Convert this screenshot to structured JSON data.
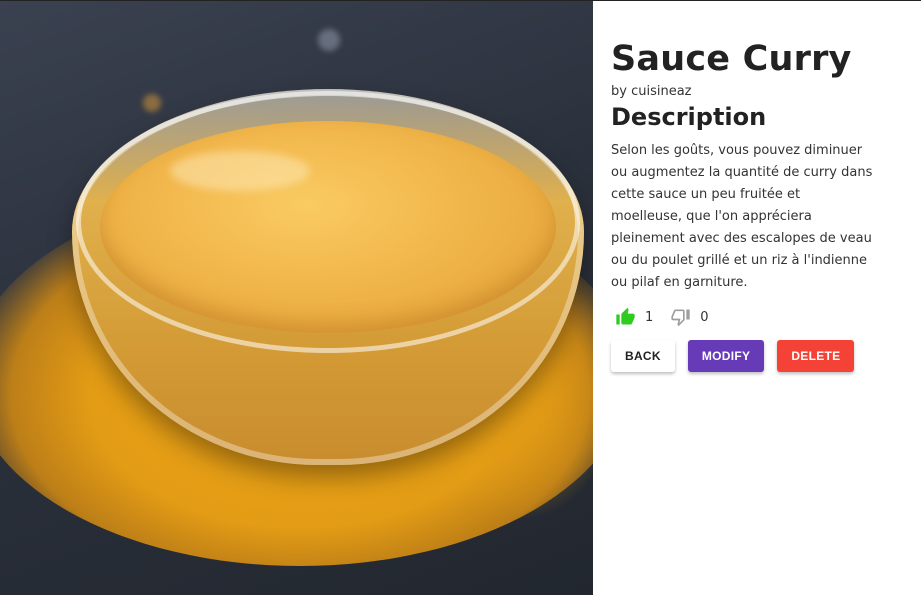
{
  "recipe": {
    "title": "Sauce Curry",
    "author": "by cuisineaz",
    "description_heading": "Description",
    "description": "Selon les goûts, vous pouvez diminuer ou augmentez la quantité de curry dans cette sauce un peu fruitée et moelleuse, que l'on appréciera pleinement avec des escalopes de veau ou du poulet grillé et un riz à l'indienne ou pilaf en garniture."
  },
  "votes": {
    "likes": "1",
    "dislikes": "0",
    "like_color": "#2ecc1f",
    "dislike_color": "#9e9e9e"
  },
  "actions": {
    "back_label": "BACK",
    "modify_label": "MODIFY",
    "delete_label": "DELETE",
    "modify_color": "#673ab7",
    "delete_color": "#f44336"
  },
  "icons": {
    "like": "thumb-up-icon",
    "dislike": "thumb-down-icon"
  }
}
